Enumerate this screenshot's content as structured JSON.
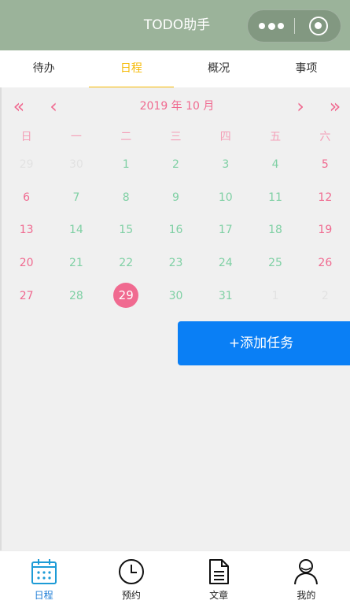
{
  "header": {
    "title": "TODO助手"
  },
  "tabs": [
    "待办",
    "日程",
    "概况",
    "事项"
  ],
  "calendar": {
    "nav": {
      "prev_year": "«",
      "prev_month": "‹",
      "next_month": "›",
      "next_year": "»"
    },
    "month_title": "2019 年 10 月",
    "weekdays": [
      "日",
      "一",
      "二",
      "三",
      "四",
      "五",
      "六"
    ],
    "weeks": [
      [
        "29",
        "30",
        "1",
        "2",
        "3",
        "4",
        "5"
      ],
      [
        "6",
        "7",
        "8",
        "9",
        "10",
        "11",
        "12"
      ],
      [
        "13",
        "14",
        "15",
        "16",
        "17",
        "18",
        "19"
      ],
      [
        "20",
        "21",
        "22",
        "23",
        "24",
        "25",
        "26"
      ],
      [
        "27",
        "28",
        "29",
        "30",
        "31",
        "1",
        "2"
      ]
    ],
    "today": "29"
  },
  "actions": {
    "add_task": "+添加任务"
  },
  "bottom_nav": [
    {
      "label": "日程",
      "icon": "calendar-icon"
    },
    {
      "label": "预约",
      "icon": "clock-icon"
    },
    {
      "label": "文章",
      "icon": "document-icon"
    },
    {
      "label": "我的",
      "icon": "user-icon"
    }
  ],
  "colors": {
    "header_bg": "#9bb39a",
    "tab_active": "#f5b800",
    "weekend": "#f06a90",
    "weekday": "#7fd0a4",
    "button": "#0a7ff5",
    "bottom_active": "#1d7cd6"
  }
}
